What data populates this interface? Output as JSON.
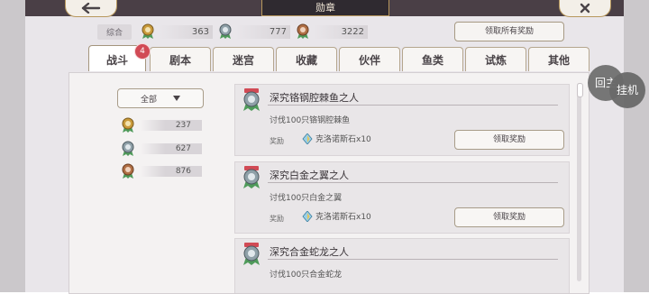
{
  "header": {
    "title": "勋章"
  },
  "summary": {
    "label": "综合",
    "items": [
      {
        "icon": "gold-medal-icon",
        "value": "363"
      },
      {
        "icon": "silver-medal-icon",
        "value": "777"
      },
      {
        "icon": "bronze-medal-icon",
        "value": "3222"
      }
    ],
    "claim_all_label": "领取所有奖励"
  },
  "tabs": [
    {
      "label": "战斗",
      "badge": "4",
      "active": true
    },
    {
      "label": "剧本"
    },
    {
      "label": "迷宫"
    },
    {
      "label": "收藏"
    },
    {
      "label": "伙伴"
    },
    {
      "label": "鱼类"
    },
    {
      "label": "试炼"
    },
    {
      "label": "其他"
    }
  ],
  "filter": {
    "selected": "全部"
  },
  "stats": [
    {
      "icon": "gold-medal-icon",
      "value": "237"
    },
    {
      "icon": "silver-medal-icon",
      "value": "627"
    },
    {
      "icon": "bronze-medal-icon",
      "value": "876"
    }
  ],
  "cards": [
    {
      "title": "深究铬钢腔棘鱼之人",
      "desc": "讨伐100只铬钢腔棘鱼",
      "reward_label": "奖励",
      "reward": "克洛诺斯石x10",
      "button": "领取奖励"
    },
    {
      "title": "深究白金之翼之人",
      "desc": "讨伐100只白金之翼",
      "reward_label": "奖励",
      "reward": "克洛诺斯石x10",
      "button": "领取奖励"
    },
    {
      "title": "深究合金蛇龙之人",
      "desc": "讨伐100只合金蛇龙"
    }
  ],
  "floating": {
    "return_label": "回主",
    "hang_label": "挂机"
  },
  "colors": {
    "accent": "#d14a55",
    "gold": "#c99a3b",
    "silver": "#8fa0a8",
    "bronze": "#b06f45",
    "ribbon_green": "#4f9a5a"
  }
}
